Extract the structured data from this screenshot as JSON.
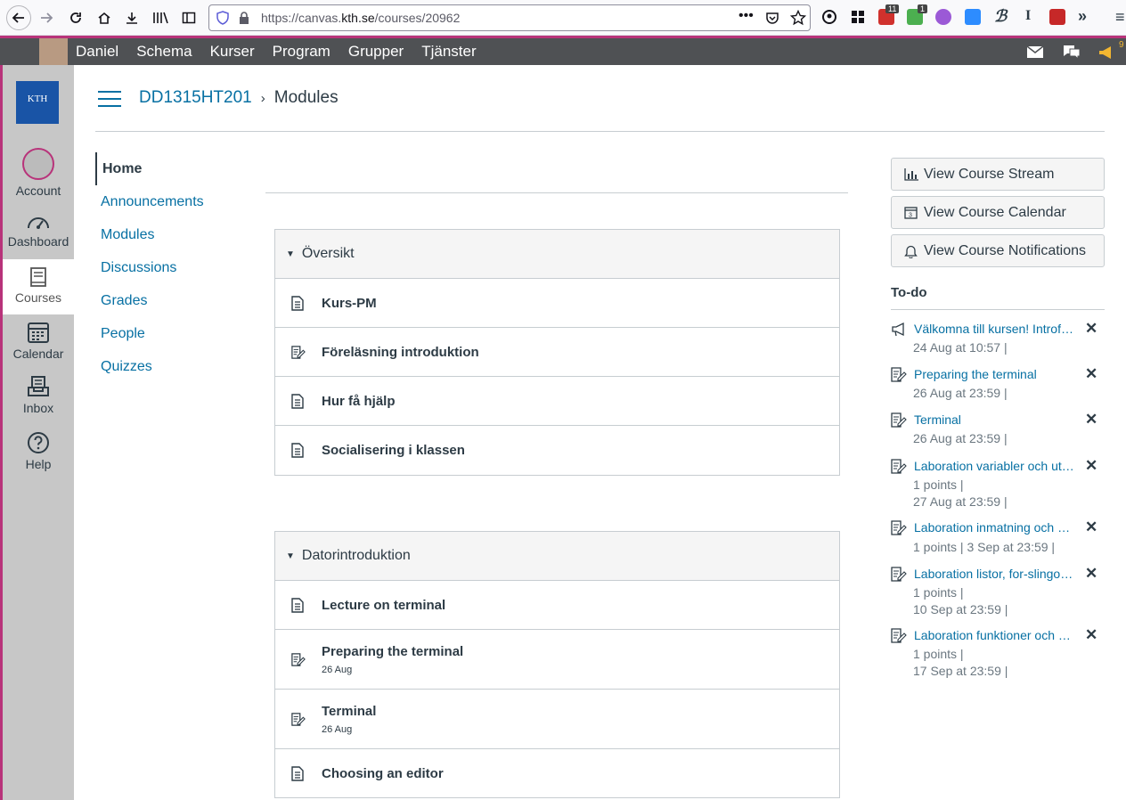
{
  "browser": {
    "url_prefix": "https://canvas.",
    "url_domain": "kth.se",
    "url_path": "/courses/20962",
    "badge1": "11",
    "badge2": "1",
    "badge3": "9"
  },
  "topnav": {
    "items": [
      "Daniel",
      "Schema",
      "Kurser",
      "Program",
      "Grupper",
      "Tjänster"
    ]
  },
  "global_nav": {
    "logo_text": "KTH",
    "account": "Account",
    "dashboard": "Dashboard",
    "courses": "Courses",
    "calendar": "Calendar",
    "inbox": "Inbox",
    "help": "Help"
  },
  "breadcrumb": {
    "course": "DD1315HT201",
    "separator": "›",
    "page": "Modules"
  },
  "course_nav": {
    "items": [
      "Home",
      "Announcements",
      "Modules",
      "Discussions",
      "Grades",
      "People",
      "Quizzes"
    ]
  },
  "modules": [
    {
      "title": "Översikt",
      "items": [
        {
          "title": "Kurs-PM",
          "icon": "page-icon",
          "sub": ""
        },
        {
          "title": "Föreläsning introduktion",
          "icon": "assignment-icon",
          "sub": ""
        },
        {
          "title": "Hur få hjälp",
          "icon": "page-icon",
          "sub": ""
        },
        {
          "title": "Socialisering i klassen",
          "icon": "page-icon",
          "sub": ""
        }
      ]
    },
    {
      "title": "Datorintroduktion",
      "items": [
        {
          "title": "Lecture on terminal",
          "icon": "page-icon",
          "sub": ""
        },
        {
          "title": "Preparing the terminal",
          "icon": "assignment-icon",
          "sub": "26 Aug"
        },
        {
          "title": "Terminal",
          "icon": "assignment-icon",
          "sub": "26 Aug"
        },
        {
          "title": "Choosing an editor",
          "icon": "page-icon",
          "sub": ""
        }
      ]
    }
  ],
  "sidebar_buttons": {
    "stream": "View Course Stream",
    "calendar": "View Course Calendar",
    "notifications": "View Course Notifications"
  },
  "todo": {
    "heading": "To-do",
    "items": [
      {
        "title": "Välkomna till kursen! Introf…",
        "line1": "24 Aug at 10:57  |",
        "line2": ""
      },
      {
        "title": "Preparing the terminal",
        "line1": "26 Aug at 23:59  |",
        "line2": ""
      },
      {
        "title": "Terminal",
        "line1": "26 Aug at 23:59  |",
        "line2": ""
      },
      {
        "title": "Laboration variabler och ut…",
        "line1": "1 points  |",
        "line2": "27 Aug at 23:59  |"
      },
      {
        "title": "Laboration inmatning och s…",
        "line1": "1 points  |  3 Sep at 23:59  |",
        "line2": ""
      },
      {
        "title": "Laboration listor, for-slingo…",
        "line1": "1 points  |",
        "line2": "10 Sep at 23:59  |"
      },
      {
        "title": "Laboration funktioner och …",
        "line1": "1 points  |",
        "line2": "17 Sep at 23:59  |"
      }
    ]
  }
}
